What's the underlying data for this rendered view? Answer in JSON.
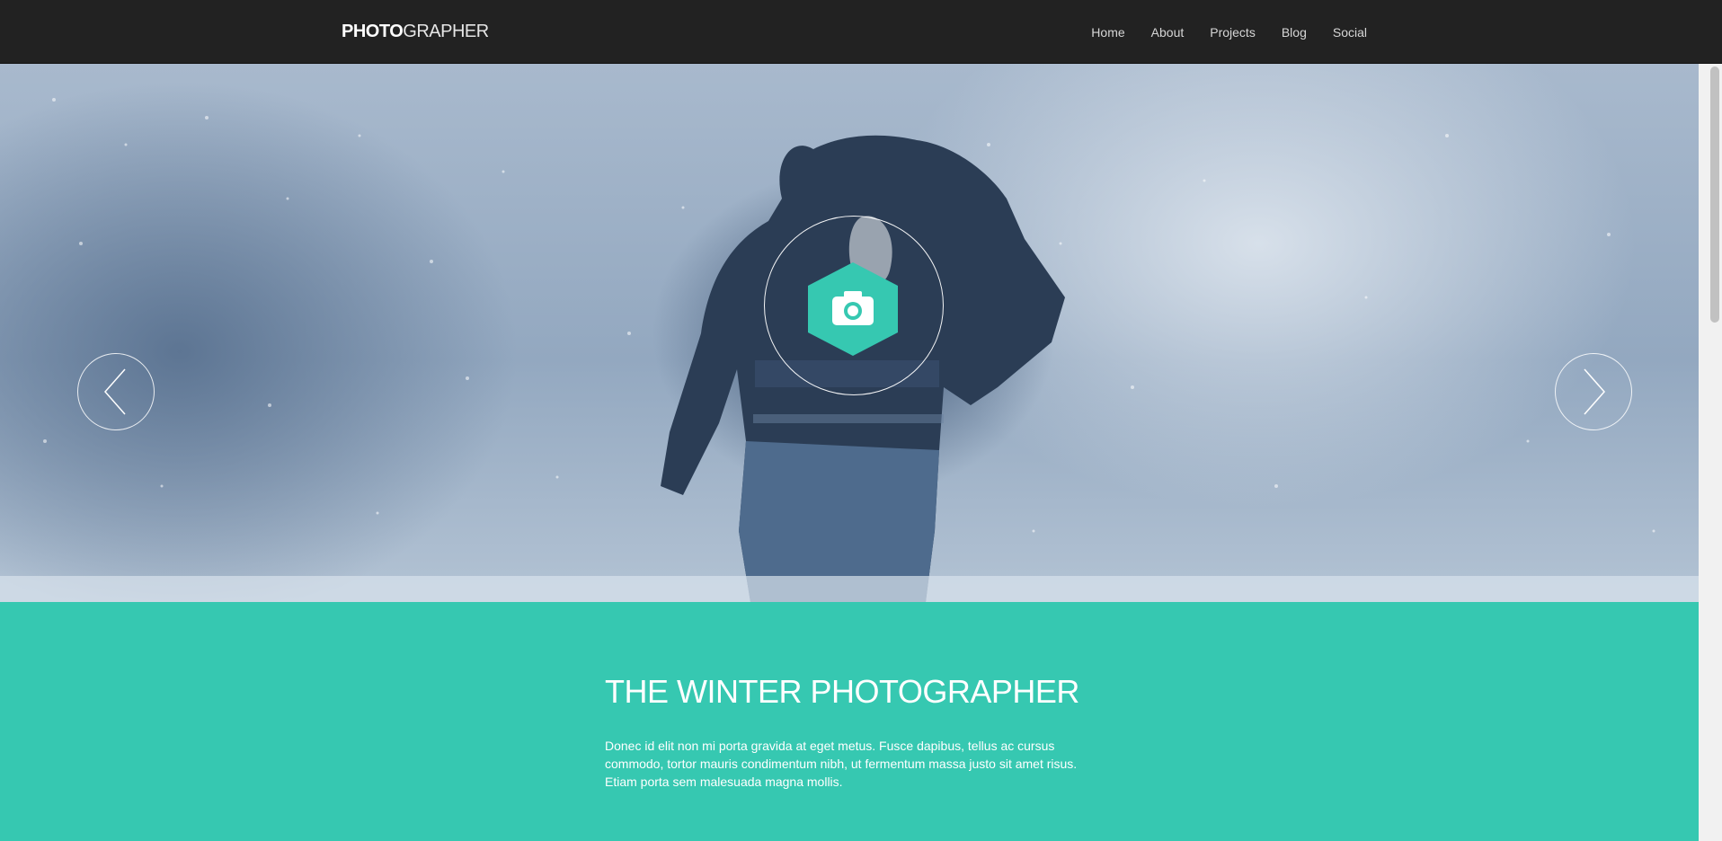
{
  "brand": {
    "bold": "PHOTO",
    "light": "GRAPHER"
  },
  "nav": [
    "Home",
    "About",
    "Projects",
    "Blog",
    "Social"
  ],
  "hero": {
    "prev_icon": "chevron-left-icon",
    "next_icon": "chevron-right-icon",
    "badge_icon": "camera-icon",
    "accent_color": "#36c8b1"
  },
  "intro": {
    "title": "THE WINTER PHOTOGRAPHER",
    "body": "Donec id elit non mi porta gravida at eget metus. Fusce dapibus, tellus ac cursus commodo, tortor mauris condimentum nibh, ut fermentum massa justo sit amet risus. Etiam porta sem malesuada magna mollis."
  }
}
